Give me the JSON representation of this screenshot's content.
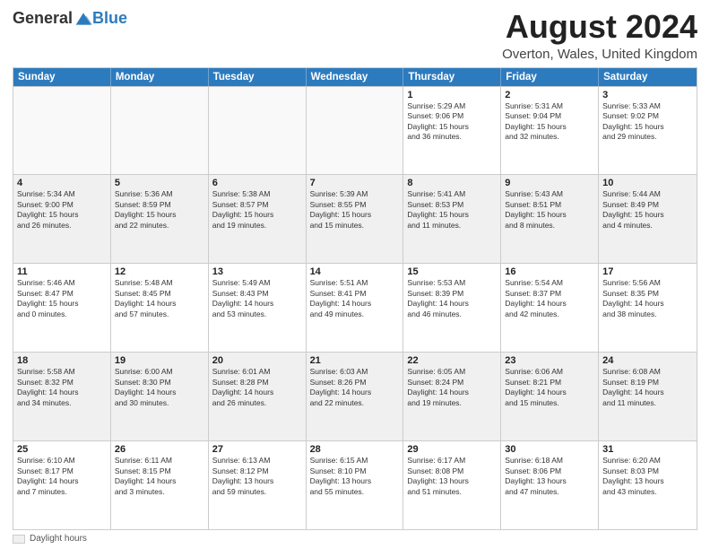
{
  "logo": {
    "general": "General",
    "blue": "Blue"
  },
  "header": {
    "title": "August 2024",
    "subtitle": "Overton, Wales, United Kingdom"
  },
  "days_of_week": [
    "Sunday",
    "Monday",
    "Tuesday",
    "Wednesday",
    "Thursday",
    "Friday",
    "Saturday"
  ],
  "legend": {
    "label": "Daylight hours"
  },
  "weeks": [
    [
      {
        "day": "",
        "info": ""
      },
      {
        "day": "",
        "info": ""
      },
      {
        "day": "",
        "info": ""
      },
      {
        "day": "",
        "info": ""
      },
      {
        "day": "1",
        "info": "Sunrise: 5:29 AM\nSunset: 9:06 PM\nDaylight: 15 hours\nand 36 minutes."
      },
      {
        "day": "2",
        "info": "Sunrise: 5:31 AM\nSunset: 9:04 PM\nDaylight: 15 hours\nand 32 minutes."
      },
      {
        "day": "3",
        "info": "Sunrise: 5:33 AM\nSunset: 9:02 PM\nDaylight: 15 hours\nand 29 minutes."
      }
    ],
    [
      {
        "day": "4",
        "info": "Sunrise: 5:34 AM\nSunset: 9:00 PM\nDaylight: 15 hours\nand 26 minutes."
      },
      {
        "day": "5",
        "info": "Sunrise: 5:36 AM\nSunset: 8:59 PM\nDaylight: 15 hours\nand 22 minutes."
      },
      {
        "day": "6",
        "info": "Sunrise: 5:38 AM\nSunset: 8:57 PM\nDaylight: 15 hours\nand 19 minutes."
      },
      {
        "day": "7",
        "info": "Sunrise: 5:39 AM\nSunset: 8:55 PM\nDaylight: 15 hours\nand 15 minutes."
      },
      {
        "day": "8",
        "info": "Sunrise: 5:41 AM\nSunset: 8:53 PM\nDaylight: 15 hours\nand 11 minutes."
      },
      {
        "day": "9",
        "info": "Sunrise: 5:43 AM\nSunset: 8:51 PM\nDaylight: 15 hours\nand 8 minutes."
      },
      {
        "day": "10",
        "info": "Sunrise: 5:44 AM\nSunset: 8:49 PM\nDaylight: 15 hours\nand 4 minutes."
      }
    ],
    [
      {
        "day": "11",
        "info": "Sunrise: 5:46 AM\nSunset: 8:47 PM\nDaylight: 15 hours\nand 0 minutes."
      },
      {
        "day": "12",
        "info": "Sunrise: 5:48 AM\nSunset: 8:45 PM\nDaylight: 14 hours\nand 57 minutes."
      },
      {
        "day": "13",
        "info": "Sunrise: 5:49 AM\nSunset: 8:43 PM\nDaylight: 14 hours\nand 53 minutes."
      },
      {
        "day": "14",
        "info": "Sunrise: 5:51 AM\nSunset: 8:41 PM\nDaylight: 14 hours\nand 49 minutes."
      },
      {
        "day": "15",
        "info": "Sunrise: 5:53 AM\nSunset: 8:39 PM\nDaylight: 14 hours\nand 46 minutes."
      },
      {
        "day": "16",
        "info": "Sunrise: 5:54 AM\nSunset: 8:37 PM\nDaylight: 14 hours\nand 42 minutes."
      },
      {
        "day": "17",
        "info": "Sunrise: 5:56 AM\nSunset: 8:35 PM\nDaylight: 14 hours\nand 38 minutes."
      }
    ],
    [
      {
        "day": "18",
        "info": "Sunrise: 5:58 AM\nSunset: 8:32 PM\nDaylight: 14 hours\nand 34 minutes."
      },
      {
        "day": "19",
        "info": "Sunrise: 6:00 AM\nSunset: 8:30 PM\nDaylight: 14 hours\nand 30 minutes."
      },
      {
        "day": "20",
        "info": "Sunrise: 6:01 AM\nSunset: 8:28 PM\nDaylight: 14 hours\nand 26 minutes."
      },
      {
        "day": "21",
        "info": "Sunrise: 6:03 AM\nSunset: 8:26 PM\nDaylight: 14 hours\nand 22 minutes."
      },
      {
        "day": "22",
        "info": "Sunrise: 6:05 AM\nSunset: 8:24 PM\nDaylight: 14 hours\nand 19 minutes."
      },
      {
        "day": "23",
        "info": "Sunrise: 6:06 AM\nSunset: 8:21 PM\nDaylight: 14 hours\nand 15 minutes."
      },
      {
        "day": "24",
        "info": "Sunrise: 6:08 AM\nSunset: 8:19 PM\nDaylight: 14 hours\nand 11 minutes."
      }
    ],
    [
      {
        "day": "25",
        "info": "Sunrise: 6:10 AM\nSunset: 8:17 PM\nDaylight: 14 hours\nand 7 minutes."
      },
      {
        "day": "26",
        "info": "Sunrise: 6:11 AM\nSunset: 8:15 PM\nDaylight: 14 hours\nand 3 minutes."
      },
      {
        "day": "27",
        "info": "Sunrise: 6:13 AM\nSunset: 8:12 PM\nDaylight: 13 hours\nand 59 minutes."
      },
      {
        "day": "28",
        "info": "Sunrise: 6:15 AM\nSunset: 8:10 PM\nDaylight: 13 hours\nand 55 minutes."
      },
      {
        "day": "29",
        "info": "Sunrise: 6:17 AM\nSunset: 8:08 PM\nDaylight: 13 hours\nand 51 minutes."
      },
      {
        "day": "30",
        "info": "Sunrise: 6:18 AM\nSunset: 8:06 PM\nDaylight: 13 hours\nand 47 minutes."
      },
      {
        "day": "31",
        "info": "Sunrise: 6:20 AM\nSunset: 8:03 PM\nDaylight: 13 hours\nand 43 minutes."
      }
    ]
  ]
}
